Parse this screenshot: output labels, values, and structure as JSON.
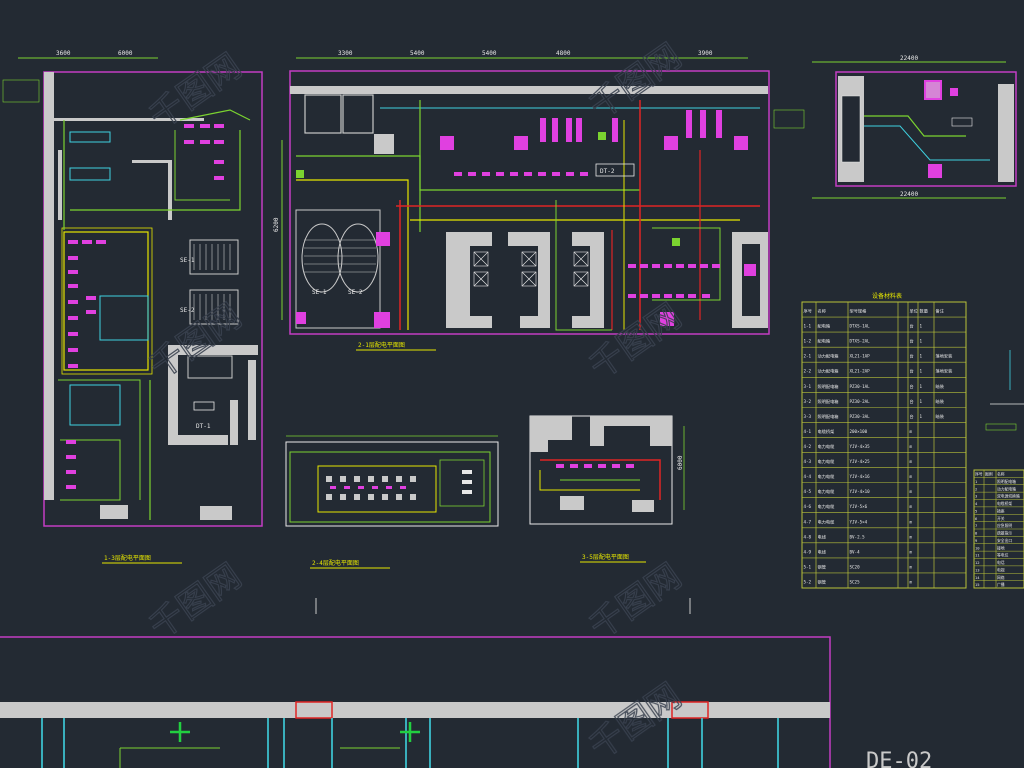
{
  "colors": {
    "background": "#232a33",
    "frame": "#c33cc3",
    "wall": "#c9c9c9",
    "cable_green": "#7bd330",
    "cable_yellow": "#e6e600",
    "cable_red": "#e02424",
    "cable_cyan": "#3fd1e0",
    "device_magenta": "#e040e0",
    "table_line": "#b9c23a",
    "text_white": "#e8e8e8",
    "text_yellow": "#e6e600",
    "watermark": "#3a4250"
  },
  "watermark": "千图网",
  "plans": {
    "left_title": "1-3层配电平面图",
    "center_title": "2-1层配电平面图",
    "upper_right_title": "3-1层配电平面图",
    "middle_small_title": "2-4层配电平面图",
    "right_small_title": "3-5层配电平面图"
  },
  "dims": {
    "top_center": [
      "3300",
      "5400",
      "5400",
      "4800",
      "3900"
    ],
    "upper_right_top": "22400",
    "upper_right_bottom": "22400",
    "left_top": [
      "3600",
      "6000"
    ],
    "center_side": "6200",
    "right_small_side": "6000"
  },
  "room_labels": {
    "left_mid_a": "SE-1",
    "left_mid_b": "SE-2",
    "left_bottom": "DT-1",
    "center_stair_a": "SE-1",
    "center_stair_b": "SE-2",
    "center_panel": "DT-2"
  },
  "schedule": {
    "title": "设备材料表",
    "headers": [
      "序号",
      "名称",
      "型号规格",
      "单位",
      "数量",
      "备注"
    ],
    "rows": [
      [
        "1-1",
        "配电箱",
        "DTXS-1AL",
        "台",
        "1",
        ""
      ],
      [
        "1-2",
        "配电箱",
        "DTXS-2AL",
        "台",
        "1",
        ""
      ],
      [
        "2-1",
        "动力配电箱",
        "XL21-1AP",
        "台",
        "1",
        "落地安装"
      ],
      [
        "2-2",
        "动力配电箱",
        "XL21-2AP",
        "台",
        "1",
        "落地安装"
      ],
      [
        "3-1",
        "照明配电箱",
        "PZ30-1AL",
        "台",
        "1",
        "暗装"
      ],
      [
        "3-2",
        "照明配电箱",
        "PZ30-2AL",
        "台",
        "1",
        "暗装"
      ],
      [
        "3-3",
        "照明配电箱",
        "PZ30-3AL",
        "台",
        "1",
        "暗装"
      ],
      [
        "4-1",
        "电缆桥架",
        "200×100",
        "m",
        "",
        ""
      ],
      [
        "4-2",
        "电力电缆",
        "YJV-4×35",
        "m",
        "",
        ""
      ],
      [
        "4-3",
        "电力电缆",
        "YJV-4×25",
        "m",
        "",
        ""
      ],
      [
        "4-4",
        "电力电缆",
        "YJV-4×16",
        "m",
        "",
        ""
      ],
      [
        "4-5",
        "电力电缆",
        "YJV-4×10",
        "m",
        "",
        ""
      ],
      [
        "4-6",
        "电力电缆",
        "YJV-5×6",
        "m",
        "",
        ""
      ],
      [
        "4-7",
        "电力电缆",
        "YJV-5×4",
        "m",
        "",
        ""
      ],
      [
        "4-8",
        "电线",
        "BV-2.5",
        "m",
        "",
        ""
      ],
      [
        "4-9",
        "电线",
        "BV-4",
        "m",
        "",
        ""
      ],
      [
        "5-1",
        "钢管",
        "SC20",
        "m",
        "",
        ""
      ],
      [
        "5-2",
        "钢管",
        "SC25",
        "m",
        "",
        ""
      ]
    ]
  },
  "legend": {
    "headers": [
      "序号",
      "图例",
      "名称"
    ],
    "rows": [
      [
        "1",
        "",
        "照明配电箱"
      ],
      [
        "2",
        "",
        "动力配电箱"
      ],
      [
        "3",
        "",
        "双电源切换箱"
      ],
      [
        "4",
        "",
        "电缆桥架"
      ],
      [
        "5",
        "",
        "插座"
      ],
      [
        "6",
        "",
        "开关"
      ],
      [
        "7",
        "",
        "应急照明"
      ],
      [
        "8",
        "",
        "疏散指示"
      ],
      [
        "9",
        "",
        "安全出口"
      ],
      [
        "10",
        "",
        "接地"
      ],
      [
        "11",
        "",
        "等电位"
      ],
      [
        "12",
        "",
        "电话"
      ],
      [
        "13",
        "",
        "电视"
      ],
      [
        "14",
        "",
        "网络"
      ],
      [
        "15",
        "",
        "广播"
      ]
    ]
  },
  "bottom_label": "DE-02"
}
